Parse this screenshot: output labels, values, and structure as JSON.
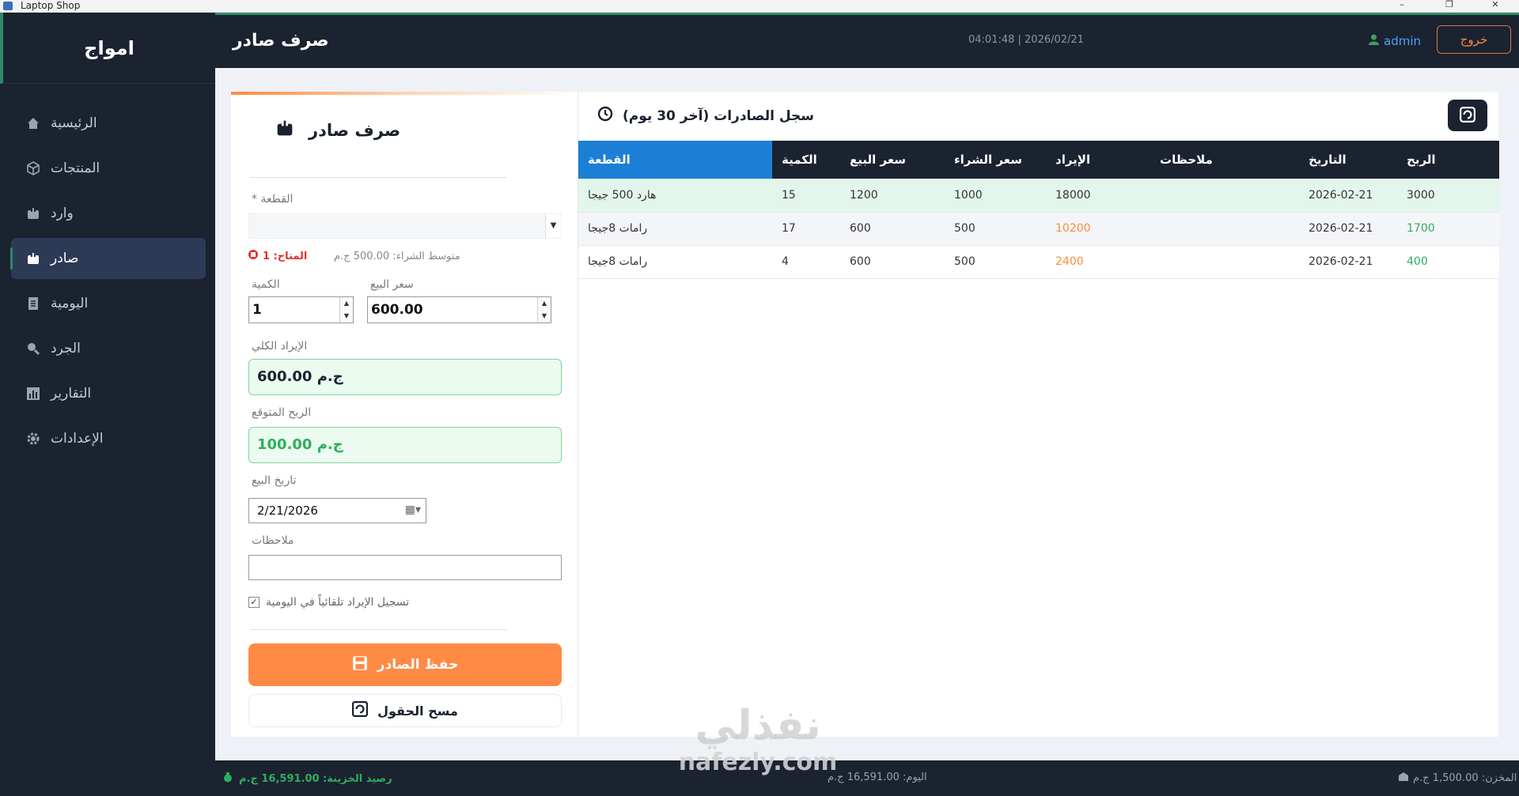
{
  "window": {
    "title": "Laptop Shop",
    "controls": [
      "–",
      "❐",
      "✕"
    ]
  },
  "sidebar": {
    "brand": "امواج",
    "items": [
      {
        "label": "الرئيسية",
        "icon": "home-icon"
      },
      {
        "label": "المنتجات",
        "icon": "box-icon"
      },
      {
        "label": "وارد",
        "icon": "inbox-icon"
      },
      {
        "label": "صادر",
        "icon": "outbox-icon",
        "active": true
      },
      {
        "label": "اليومية",
        "icon": "journal-icon"
      },
      {
        "label": "الجرد",
        "icon": "search-icon"
      },
      {
        "label": "التقارير",
        "icon": "chart-icon"
      },
      {
        "label": "الإعدادات",
        "icon": "gear-icon"
      }
    ]
  },
  "header": {
    "title": "صرف صادر",
    "datetime": "04:01:48  |  2026/02/21",
    "user": "admin",
    "logout_label": "خروج"
  },
  "form": {
    "title": "صرف صادر",
    "item_label": "* القطعة",
    "item_value": "",
    "available": "المتاح: 1",
    "avg_purchase": "متوسط الشراء: 500.00 ج.م",
    "quantity_label": "الكمية",
    "quantity_value": "1",
    "sale_price_label": "سعر البيع",
    "sale_price_value": "600.00",
    "total_revenue_label": "الإيراد الكلي",
    "total_revenue_value": "600.00 ج.م",
    "expected_profit_label": "الربح المتوقع",
    "expected_profit_value": "100.00 ج.م",
    "sale_date_label": "تاريخ البيع",
    "sale_date_value": "2/21/2026",
    "notes_label": "ملاحظات",
    "notes_value": "",
    "auto_journal_label": "تسجيل الإيراد تلقائياً في اليومية",
    "auto_journal_checked": true,
    "save_label": "حفظ الصادر",
    "clear_label": "مسح الحقول"
  },
  "history": {
    "title": "سجل الصادرات (آخر 30 يوم)",
    "columns": [
      "القطعة",
      "الكمية",
      "سعر البيع",
      "سعر الشراء",
      "الإيراد",
      "ملاحظات",
      "التاريخ",
      "الربح"
    ],
    "rows": [
      {
        "item": "هارد 500 جيجا",
        "qty": "15",
        "sale": "1200",
        "buy": "1000",
        "revenue": "18000",
        "notes": "",
        "date": "2026-02-21",
        "profit": "3000"
      },
      {
        "item": "رامات 8جيجا",
        "qty": "17",
        "sale": "600",
        "buy": "500",
        "revenue": "10200",
        "notes": "",
        "date": "2026-02-21",
        "profit": "1700"
      },
      {
        "item": "رامات 8جيجا",
        "qty": "4",
        "sale": "600",
        "buy": "500",
        "revenue": "2400",
        "notes": "",
        "date": "2026-02-21",
        "profit": "400"
      }
    ]
  },
  "status": {
    "treasury": "رصيد الخزينة: 16,591.00 ج.م",
    "today": "اليوم: 16,591.00 ج.م",
    "stock": "المخزن: 1,500.00 ج.م"
  },
  "watermark": {
    "arabic": "نفذلي",
    "latin": "nafezly.com"
  },
  "colors": {
    "sidebar_bg": "#1b2230",
    "accent_orange": "#ff8a45",
    "accent_green": "#2eae5d",
    "selected_header": "#1c7fd6"
  }
}
